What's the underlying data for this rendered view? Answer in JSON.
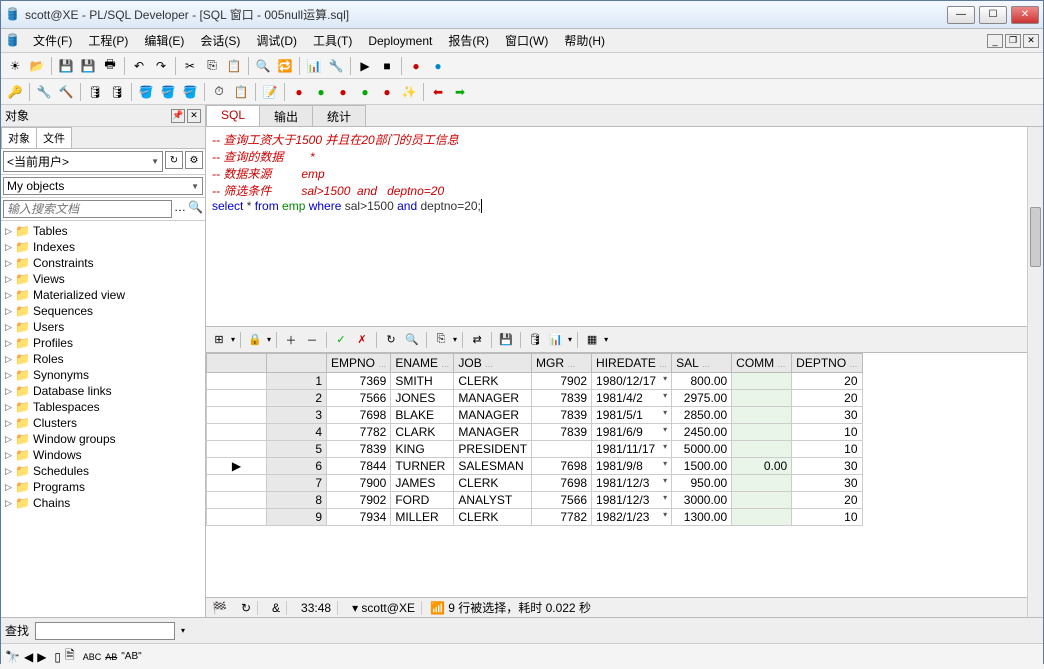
{
  "title": "scott@XE - PL/SQL Developer - [SQL 窗口 - 005null运算.sql]",
  "menus": [
    "文件(F)",
    "工程(P)",
    "编辑(E)",
    "会话(S)",
    "调试(D)",
    "工具(T)",
    "Deployment",
    "报告(R)",
    "窗口(W)",
    "帮助(H)"
  ],
  "left": {
    "header": "对象",
    "tabs": [
      "对象",
      "文件"
    ],
    "userCombo": "<当前用户>",
    "objectsCombo": "My objects",
    "searchPlaceholder": "输入搜索文档",
    "tree": [
      "Tables",
      "Indexes",
      "Constraints",
      "Views",
      "Materialized view",
      "Sequences",
      "Users",
      "Profiles",
      "Roles",
      "Synonyms",
      "Database links",
      "Tablespaces",
      "Clusters",
      "Window groups",
      "Windows",
      "Schedules",
      "Programs",
      "Chains"
    ]
  },
  "sqlTabs": [
    "SQL",
    "输出",
    "统计"
  ],
  "editor": {
    "c1": "-- 查询工资大于1500 并且在20部门的员工信息",
    "c2": "-- 查询的数据        *",
    "c3": "-- 数据来源         emp",
    "c4": "-- 筛选条件         sal>1500  and   deptno=20",
    "kw_select": "select",
    "star": " * ",
    "kw_from": "from",
    "id_emp": " emp ",
    "kw_where": "where",
    "expr": " sal>1500 ",
    "kw_and": "and",
    "expr2": " deptno=20;"
  },
  "columns": [
    "EMPNO",
    "ENAME",
    "JOB",
    "MGR",
    "HIREDATE",
    "SAL",
    "COMM",
    "DEPTNO"
  ],
  "rows": [
    {
      "n": 1,
      "EMPNO": "7369",
      "ENAME": "SMITH",
      "JOB": "CLERK",
      "MGR": "7902",
      "HIREDATE": "1980/12/17",
      "SAL": "800.00",
      "COMM": "",
      "DEPTNO": "20"
    },
    {
      "n": 2,
      "EMPNO": "7566",
      "ENAME": "JONES",
      "JOB": "MANAGER",
      "MGR": "7839",
      "HIREDATE": "1981/4/2",
      "SAL": "2975.00",
      "COMM": "",
      "DEPTNO": "20"
    },
    {
      "n": 3,
      "EMPNO": "7698",
      "ENAME": "BLAKE",
      "JOB": "MANAGER",
      "MGR": "7839",
      "HIREDATE": "1981/5/1",
      "SAL": "2850.00",
      "COMM": "",
      "DEPTNO": "30"
    },
    {
      "n": 4,
      "EMPNO": "7782",
      "ENAME": "CLARK",
      "JOB": "MANAGER",
      "MGR": "7839",
      "HIREDATE": "1981/6/9",
      "SAL": "2450.00",
      "COMM": "",
      "DEPTNO": "10"
    },
    {
      "n": 5,
      "EMPNO": "7839",
      "ENAME": "KING",
      "JOB": "PRESIDENT",
      "MGR": "",
      "HIREDATE": "1981/11/17",
      "SAL": "5000.00",
      "COMM": "",
      "DEPTNO": "10"
    },
    {
      "n": 6,
      "EMPNO": "7844",
      "ENAME": "TURNER",
      "JOB": "SALESMAN",
      "MGR": "7698",
      "HIREDATE": "1981/9/8",
      "SAL": "1500.00",
      "COMM": "0.00",
      "DEPTNO": "30",
      "cur": true
    },
    {
      "n": 7,
      "EMPNO": "7900",
      "ENAME": "JAMES",
      "JOB": "CLERK",
      "MGR": "7698",
      "HIREDATE": "1981/12/3",
      "SAL": "950.00",
      "COMM": "",
      "DEPTNO": "30"
    },
    {
      "n": 8,
      "EMPNO": "7902",
      "ENAME": "FORD",
      "JOB": "ANALYST",
      "MGR": "7566",
      "HIREDATE": "1981/12/3",
      "SAL": "3000.00",
      "COMM": "",
      "DEPTNO": "20"
    },
    {
      "n": 9,
      "EMPNO": "7934",
      "ENAME": "MILLER",
      "JOB": "CLERK",
      "MGR": "7782",
      "HIREDATE": "1982/1/23",
      "SAL": "1300.00",
      "COMM": "",
      "DEPTNO": "10"
    }
  ],
  "status": {
    "pos": "33:48",
    "conn": "scott@XE",
    "msg": "9 行被选择，耗时 0.022 秒"
  },
  "findLabel": "查找",
  "abBtn": "\"AB\""
}
